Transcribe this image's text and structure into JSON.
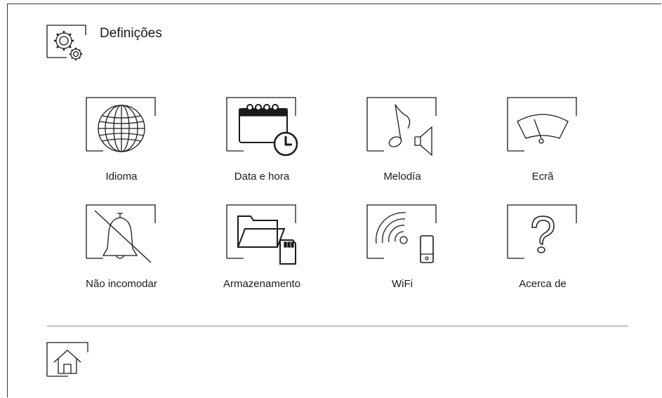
{
  "header": {
    "title": "Definições",
    "icon": "settings-gears-icon"
  },
  "menu": [
    {
      "id": "idioma",
      "label": "Idioma",
      "icon": "globe-icon"
    },
    {
      "id": "data-hora",
      "label": "Data e hora",
      "icon": "calendar-clock-icon"
    },
    {
      "id": "melodia",
      "label": "Melodía",
      "icon": "music-note-speaker-icon"
    },
    {
      "id": "ecra",
      "label": "Ecrã",
      "icon": "screen-gauge-icon"
    },
    {
      "id": "nao-incomodar",
      "label": "Não incomodar",
      "icon": "bell-muted-icon"
    },
    {
      "id": "armazenamento",
      "label": "Armazenamento",
      "icon": "folder-sdcard-icon"
    },
    {
      "id": "wifi",
      "label": "WiFi",
      "icon": "wifi-phone-icon"
    },
    {
      "id": "acerca",
      "label": "Acerca de",
      "icon": "question-mark-icon"
    }
  ],
  "footer": {
    "home_icon": "home-icon"
  },
  "colors": {
    "line": "#1a1a1a",
    "divider": "#8a8a8a",
    "background": "#ffffff"
  }
}
